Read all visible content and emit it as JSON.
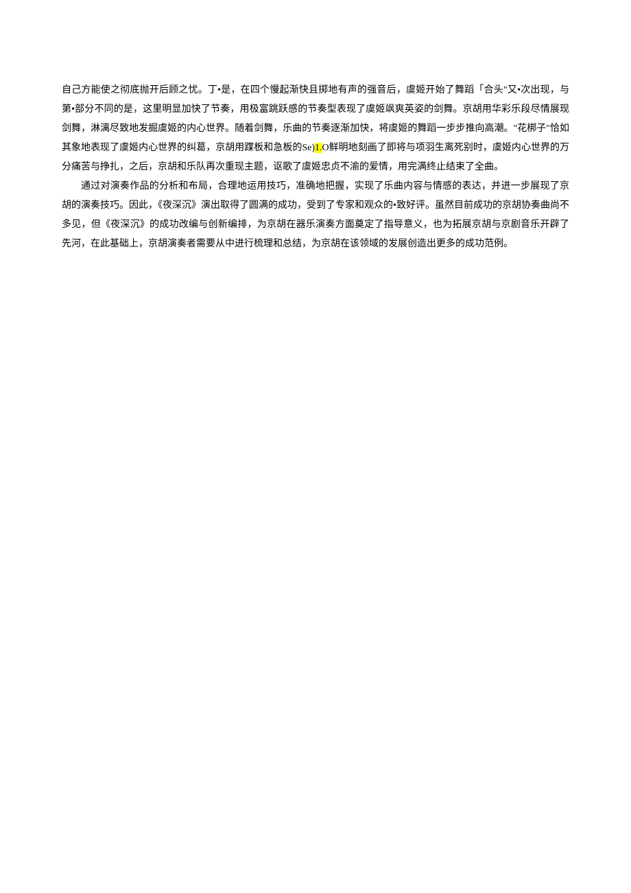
{
  "paragraphs": {
    "p1_part1": "自己方能使之彻底抛开后顾之忧。丁•是，在四个慢起渐快且掷地有声的强音后，虞姬开始了舞蹈「合头\"又•次出现，与第•部分不同的是，这里明显加快了节奏，用极富跳跃感的节奏型表现了虞姬飒爽英姿的剑舞。京胡用华彩乐段尽情展现剑舞，淋漓尽致地发掘虞姬的内心世界。随着剑舞，乐曲的节奏逐渐加快，将虞姬的舞蹈一步步推向高潮。\"花梆子\"恰如其象地表现了虞姬内心世界的纠葛，京胡用蹀板和急板的Se)",
    "p1_highlight": "1.",
    "p1_part2": "O鲜明地刻画了即将与项羽生离死别时，虞姬内心世界的万分痛苦与挣扎，之后，京胡和乐队再次重现主题，讴歌了虞姬忠贞不渝的爱情，用完满终止结束了全曲。",
    "p2": "通过对演奏作品的分析和布局，合理地运用技巧，准确地把握，实现了乐曲内容与情感的表达，并进一步展现了京胡的演奏技巧。因此，《夜深沉》演出取得了圆满的成功，受到了专家和观众的•致好评。虽然目前成功的京胡协奏曲尚不多见，但《夜深沉》的成功改编与创新编排，为京胡在器乐演奏方面奠定了指导意义，也为拓展京胡与京剧音乐开辟了先河，在此基础上，京胡演奏者需要从中进行梳理和总结，为京胡在该领域的发展创造出更多的成功范例。"
  }
}
